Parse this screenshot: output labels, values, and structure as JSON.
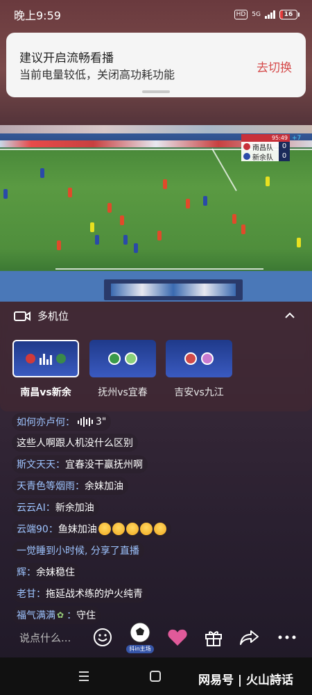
{
  "status_bar": {
    "time": "晚上9:59",
    "hd": "HD",
    "network": "5G",
    "battery": "16",
    "battery_level": 0.16,
    "battery_color": "#e53a3a"
  },
  "notice": {
    "title": "建议开启流畅看播",
    "subtitle": "当前电量较低，关闭高功耗功能",
    "action": "去切换",
    "action_color": "#d54a4a"
  },
  "video": {
    "scoreboard": {
      "clock": "95:49",
      "extra": "+7",
      "home_team": "南昌队",
      "home_score": "0",
      "away_team": "新余队",
      "away_score": "0"
    }
  },
  "multicam": {
    "title": "多机位",
    "icon": "multi-camera-icon",
    "collapse_icon": "chevron-up-icon",
    "views": [
      {
        "label": "南昌vs新余",
        "active": true
      },
      {
        "label": "抚州vs宜春",
        "active": false
      },
      {
        "label": "吉安vs九江",
        "active": false
      }
    ]
  },
  "chat": [
    {
      "user": "如何亦卢何：",
      "text": "3\"",
      "type": "voice"
    },
    {
      "user": "",
      "text": "这些人啊跟人机没什么区别"
    },
    {
      "user": "斯文天天：",
      "text": "宜春没干赢抚州啊"
    },
    {
      "user": "天青色等烟雨：",
      "text": "余妹加油"
    },
    {
      "user": "云云AI：",
      "text": "新余加油"
    },
    {
      "user": "云端90：",
      "text": "鱼妹加油",
      "emoji_count": 5
    },
    {
      "user": "",
      "text": "一觉睡到小时候, 分享了直播"
    },
    {
      "user": "辉：",
      "text": "余妹稳住"
    },
    {
      "user": "老甘：",
      "text": "拖延战术练的炉火纯青"
    },
    {
      "user": "福气满满",
      "text": "守住",
      "leaf": true
    }
  ],
  "input_bar": {
    "placeholder": "说点什么...",
    "ball_label": "抖in主场",
    "icons": [
      "emoji-icon",
      "football-icon",
      "heart-icon",
      "gift-icon",
      "share-icon",
      "more-icon"
    ]
  },
  "nav_bar": {
    "icons": [
      "menu-icon",
      "home-icon",
      "back-icon"
    ]
  },
  "watermark": {
    "text": "网易号 | 火山詩话"
  }
}
